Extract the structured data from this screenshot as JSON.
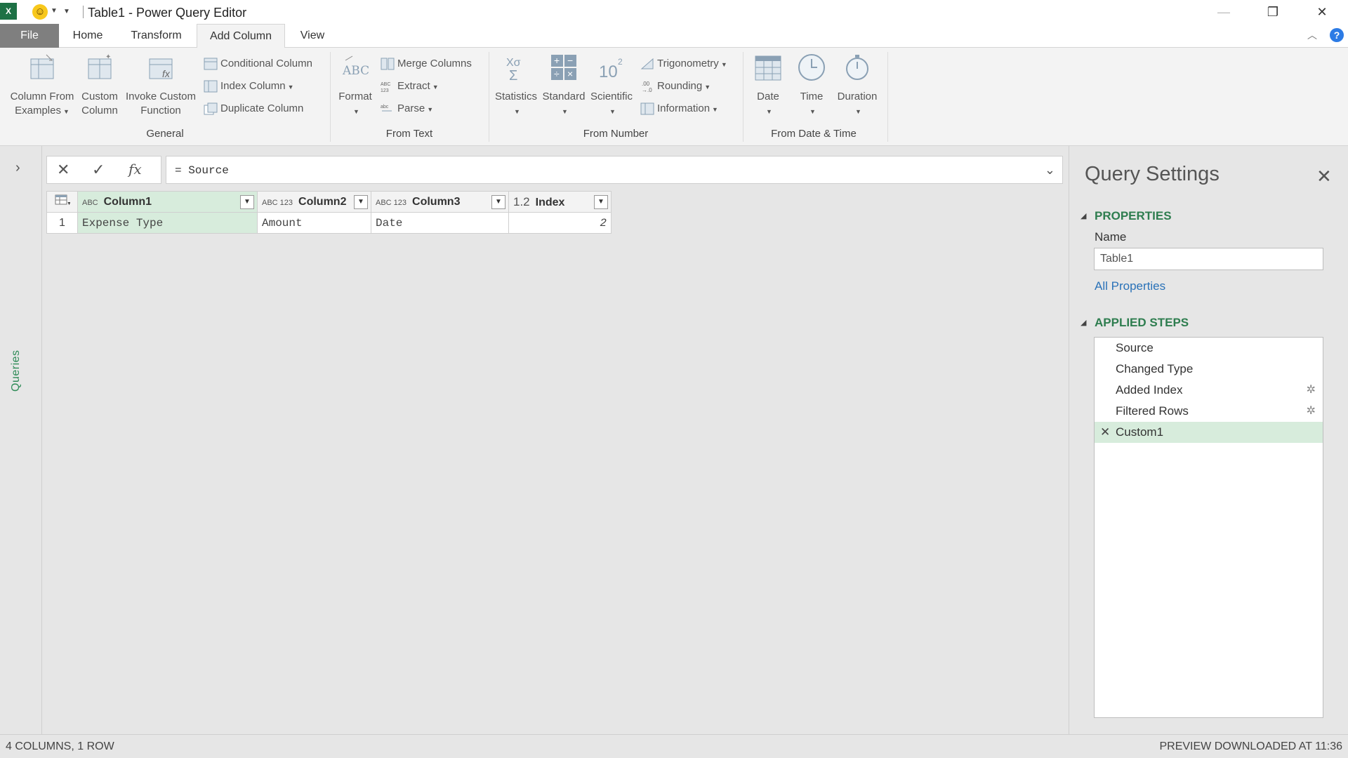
{
  "window": {
    "app_icon": "X",
    "title": "Table1 - Power Query Editor",
    "minimize": "—",
    "restore": "❐",
    "close": "✕"
  },
  "tabs": [
    "File",
    "Home",
    "Transform",
    "Add Column",
    "View"
  ],
  "active_tab": "Add Column",
  "ribbon": {
    "general": {
      "label": "General",
      "column_from_examples": [
        "Column From",
        "Examples"
      ],
      "custom_column": [
        "Custom",
        "Column"
      ],
      "invoke_custom_function": [
        "Invoke Custom",
        "Function"
      ],
      "conditional_column": "Conditional Column",
      "index_column": "Index Column",
      "duplicate_column": "Duplicate Column"
    },
    "from_text": {
      "label": "From Text",
      "format": "Format",
      "merge_columns": "Merge Columns",
      "extract": "Extract",
      "parse": "Parse"
    },
    "from_number": {
      "label": "From Number",
      "statistics": "Statistics",
      "standard": "Standard",
      "scientific": "Scientific",
      "trigonometry": "Trigonometry",
      "rounding": "Rounding",
      "information": "Information"
    },
    "from_date_time": {
      "label": "From Date & Time",
      "date": "Date",
      "time": "Time",
      "duration": "Duration"
    }
  },
  "queries_pane": {
    "label": "Queries"
  },
  "formula_bar": {
    "formula": "= Source"
  },
  "grid": {
    "columns": [
      {
        "name": "Column1",
        "type": "ABC"
      },
      {
        "name": "Column2",
        "type": "ABC 123"
      },
      {
        "name": "Column3",
        "type": "ABC 123"
      },
      {
        "name": "Index",
        "type": "1.2"
      }
    ],
    "rows": [
      {
        "num": "1",
        "cells": [
          "Expense Type",
          "Amount",
          "Date",
          "2"
        ]
      }
    ]
  },
  "query_settings": {
    "title": "Query Settings",
    "properties_label": "PROPERTIES",
    "name_label": "Name",
    "name_value": "Table1",
    "all_properties": "All Properties",
    "applied_steps_label": "APPLIED STEPS",
    "steps": [
      "Source",
      "Changed Type",
      "Added Index",
      "Filtered Rows",
      "Custom1"
    ],
    "active_step": "Custom1"
  },
  "status": {
    "left": "4 COLUMNS, 1 ROW",
    "right": "PREVIEW DOWNLOADED AT 11:36"
  },
  "colors": {
    "accent_green": "#2e7d4f",
    "selected_bg": "#d7ecdc",
    "link_blue": "#2a72b8"
  }
}
